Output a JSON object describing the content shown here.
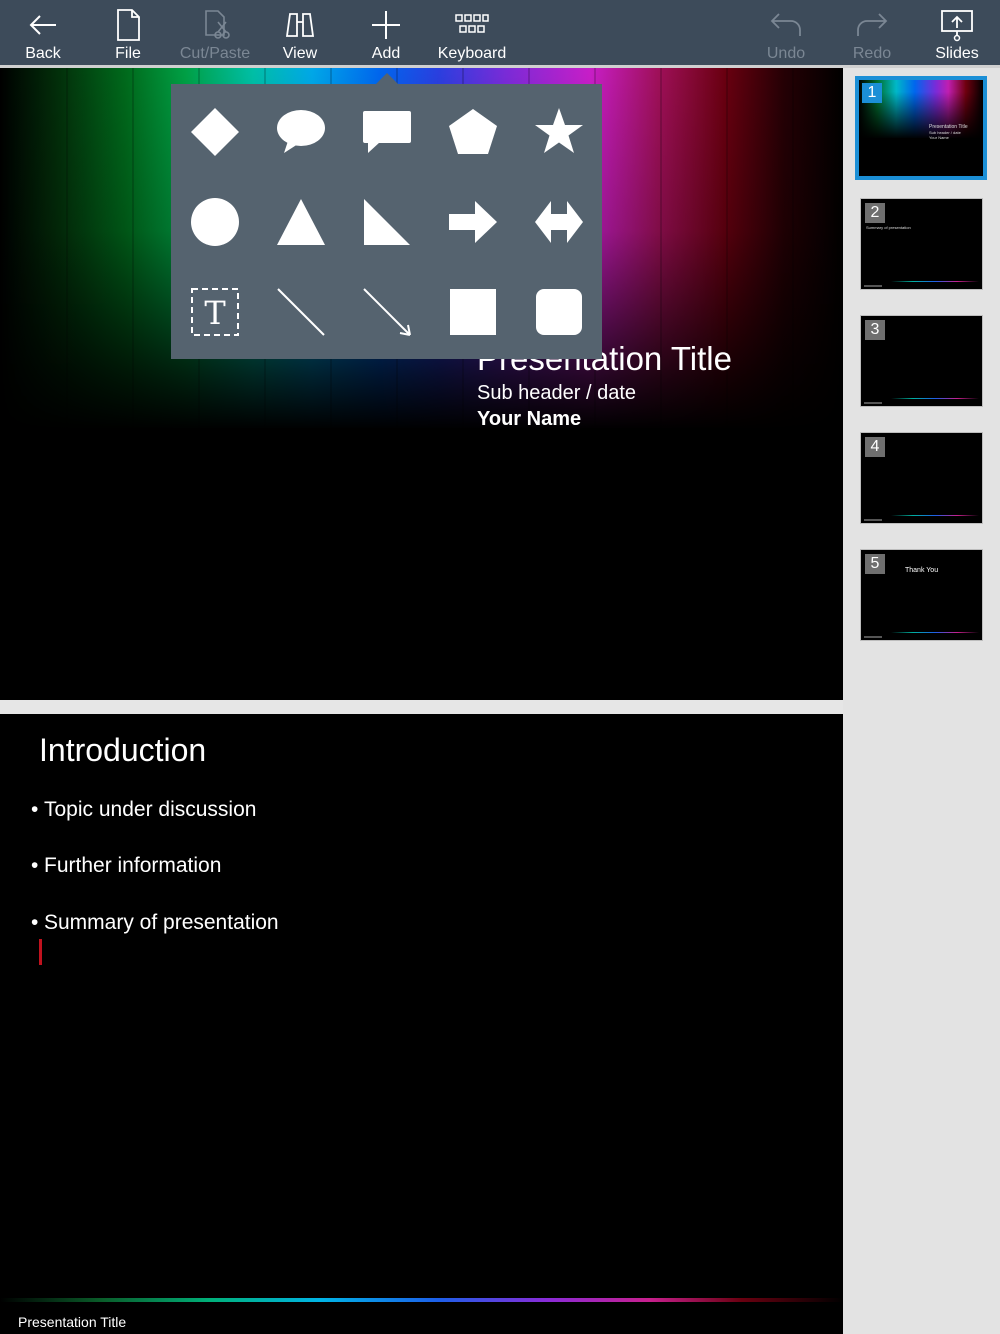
{
  "toolbar": {
    "back": "Back",
    "file": "File",
    "cut_paste": "Cut/Paste",
    "view": "View",
    "add": "Add",
    "keyboard": "Keyboard",
    "undo": "Undo",
    "redo": "Redo",
    "slides": "Slides"
  },
  "shapes_popup": {
    "items": [
      "diamond",
      "speech-bubble",
      "callout",
      "pentagon",
      "star",
      "circle",
      "triangle",
      "right-triangle",
      "arrow-right",
      "double-arrow",
      "text-box",
      "line",
      "arrow-line",
      "square",
      "rounded-square"
    ]
  },
  "slide1": {
    "title": "Presentation Title",
    "subtitle": "Sub header / date",
    "name": "Your Name"
  },
  "slide2": {
    "title": "Introduction",
    "bullets": [
      "Topic under discussion",
      "Further information",
      "Summary of presentation"
    ],
    "footer": "Presentation Title"
  },
  "thumbnails": [
    {
      "number": "1",
      "selected": true
    },
    {
      "number": "2",
      "selected": false
    },
    {
      "number": "3",
      "selected": false
    },
    {
      "number": "4",
      "selected": false
    },
    {
      "number": "5",
      "selected": false,
      "caption": "Thank You"
    }
  ],
  "colors": {
    "toolbar_bg": "#3d4b5a",
    "popup_bg": "#55636f",
    "selection": "#1b8fd6",
    "cursor": "#c0121e"
  }
}
